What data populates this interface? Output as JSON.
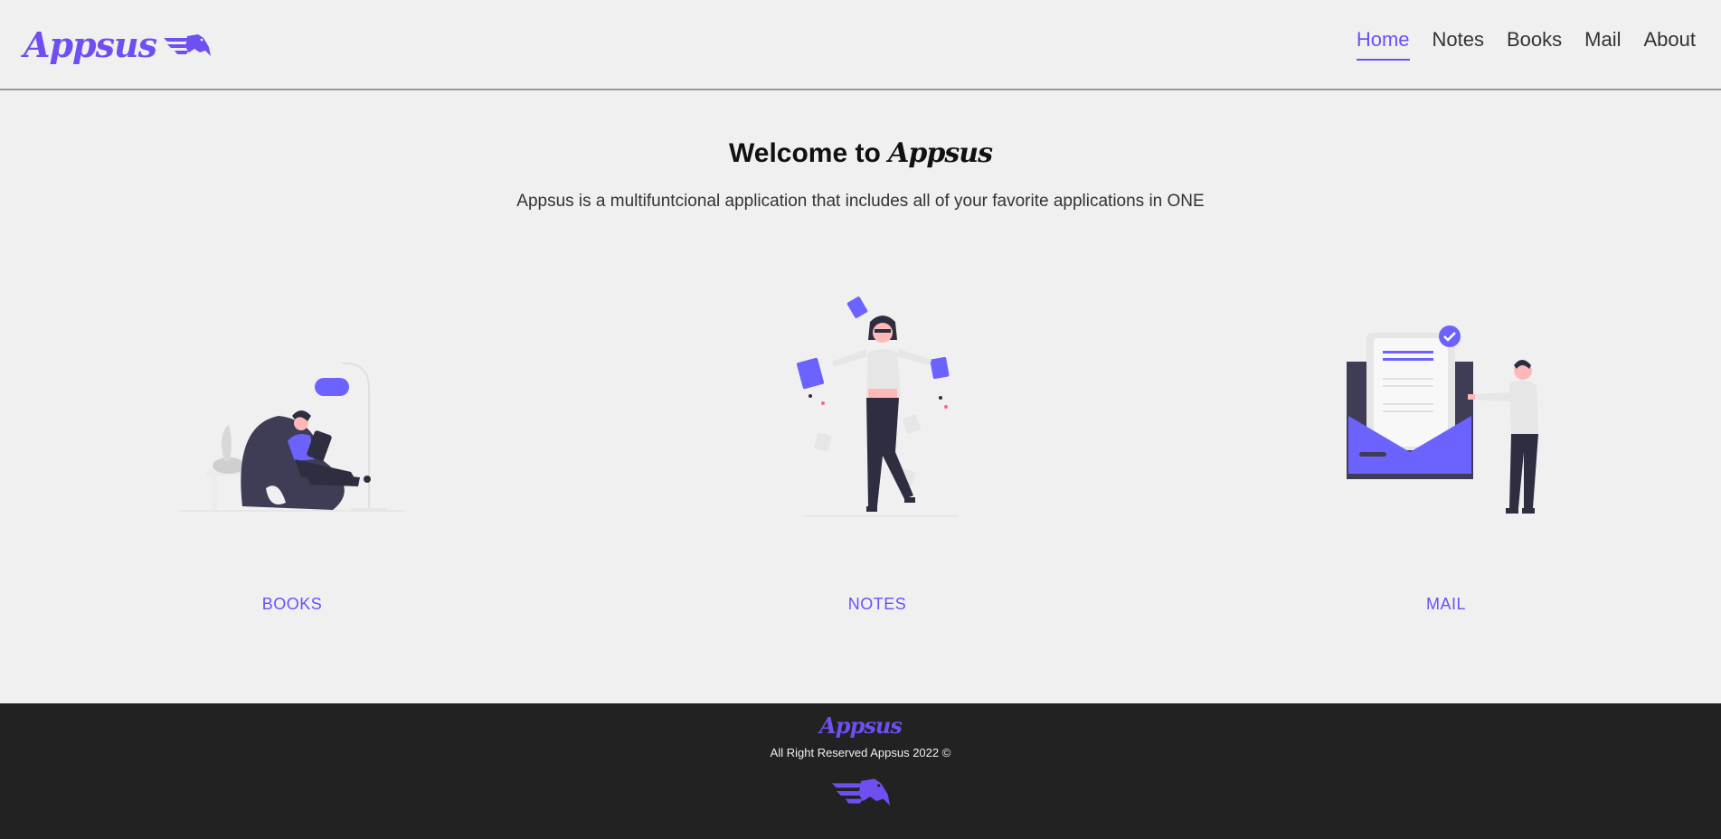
{
  "header": {
    "logo_text": "Appsus",
    "logo_icon": "flying-horse-icon",
    "nav": [
      {
        "label": "Home",
        "active": true
      },
      {
        "label": "Notes",
        "active": false
      },
      {
        "label": "Books",
        "active": false
      },
      {
        "label": "Mail",
        "active": false
      },
      {
        "label": "About",
        "active": false
      }
    ]
  },
  "main": {
    "welcome_prefix": "Welcome to ",
    "welcome_brand": "Appsus",
    "subtitle": "Appsus is a multifuntcional application that includes all of your favorite applications in ONE",
    "cards": [
      {
        "label": "BOOKS",
        "illustration": "reading-woman-illustration"
      },
      {
        "label": "NOTES",
        "illustration": "juggling-notes-woman-illustration"
      },
      {
        "label": "MAIL",
        "illustration": "man-with-mailbox-illustration"
      }
    ]
  },
  "footer": {
    "logo_text": "Appsus",
    "copyright": "All Right Reserved Appsus 2022 ©",
    "icon": "flying-horse-icon"
  },
  "colors": {
    "accent": "#6f4ff2",
    "background": "#f0f0f0",
    "footer_bg": "#222222",
    "dark_figure": "#2f2e41"
  }
}
